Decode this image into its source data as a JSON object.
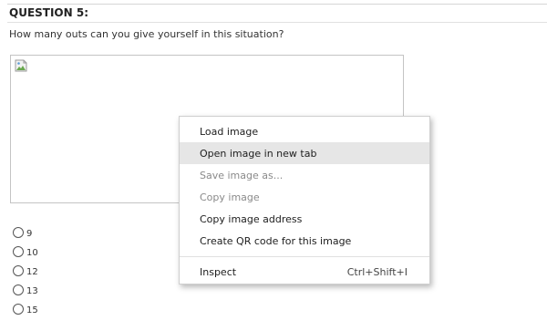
{
  "question": {
    "title": "QUESTION 5:",
    "text": "How many outs can you give yourself in this situation?"
  },
  "image": {
    "broken_icon": "broken-image-icon"
  },
  "options": [
    {
      "label": "9"
    },
    {
      "label": "10"
    },
    {
      "label": "12"
    },
    {
      "label": "13"
    },
    {
      "label": "15"
    }
  ],
  "context_menu": {
    "items": [
      {
        "label": "Load image",
        "state": "normal"
      },
      {
        "label": "Open image in new tab",
        "state": "hover"
      },
      {
        "label": "Save image as...",
        "state": "disabled"
      },
      {
        "label": "Copy image",
        "state": "disabled"
      },
      {
        "label": "Copy image address",
        "state": "normal"
      },
      {
        "label": "Create QR code for this image",
        "state": "normal"
      }
    ],
    "inspect": {
      "label": "Inspect",
      "shortcut": "Ctrl+Shift+I"
    }
  },
  "colors": {
    "hover_bg": "#e6e6e6",
    "disabled_text": "#8a8a8a"
  }
}
